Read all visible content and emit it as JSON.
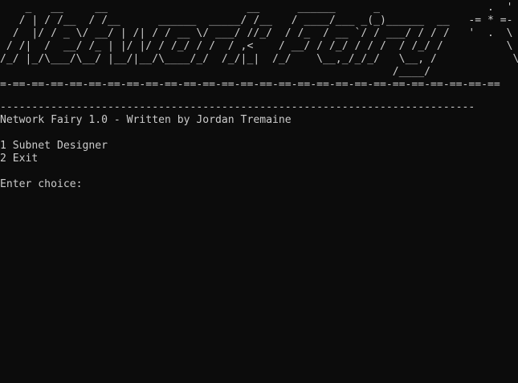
{
  "banner": {
    "ascii_art": "    _   __     __                      __      ______      _                 .  '  .\n   / | / /__  / /__      ______  _____/ /__   / ____/___ _(_)______  __   -= * =-\n  /  |/ / _ \\/ __/ | /| / / __ \\/ ___/ //_/  / /_  / __ `/ / ___/ / / /   '  .  \\\n / /|  /  __/ /_ | |/ |/ / /_/ / /  / ,<    / __/ / /_/ / / /  / /_/ /          \\\n/_/ |_/\\___/\\__/ |__/|__/\\____/_/  /_/|_|  /_/    \\__,_/_/_/   \\__, /            \\\n                                                              /____/              \\",
    "separator": "=-==-==-==-==-==-==-==-==-==-==-==-==-==-==-==-==-==-==-==-==-==-==-==-==-==-=="
  },
  "rule": "---------------------------------------------------------------------------",
  "header_line": "Network Fairy 1.0 - Written by Jordan Tremaine",
  "menu": {
    "items": [
      {
        "number": "1",
        "label": "Subnet Designer",
        "text": "1 Subnet Designer"
      },
      {
        "number": "2",
        "label": "Exit",
        "text": "2 Exit"
      }
    ]
  },
  "prompt": "Enter choice:"
}
